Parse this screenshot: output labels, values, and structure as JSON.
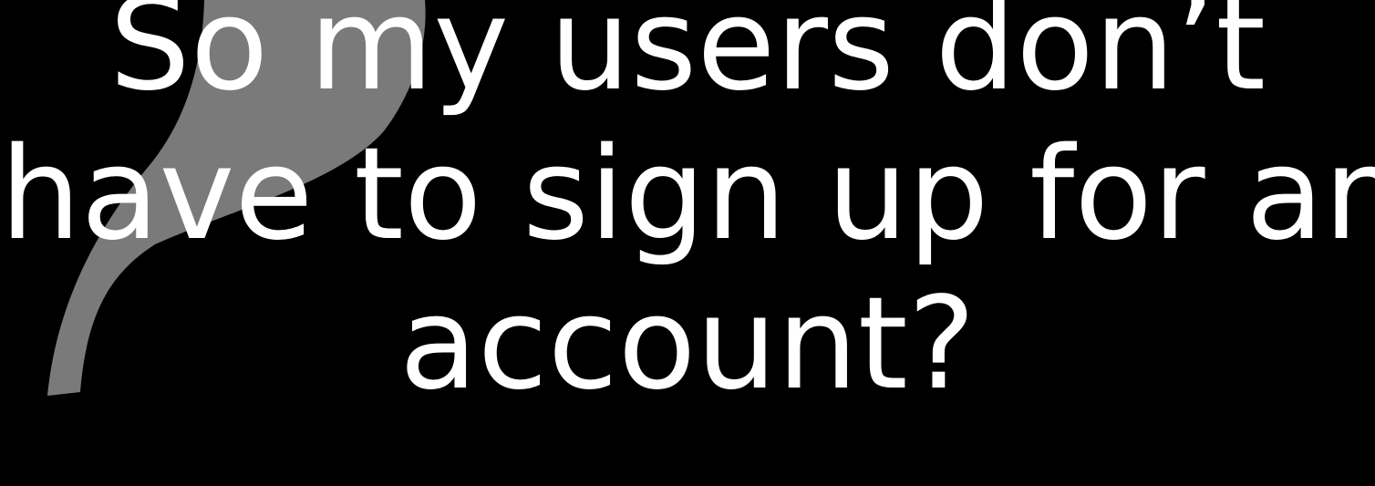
{
  "slide": {
    "lines": [
      "So my users don’t",
      "have to sign up for an",
      "account?"
    ],
    "background_color": "#000000",
    "text_color": "#ffffff",
    "quote_mark_color": "#7a7a7a",
    "decoration_icon": "quote-mark-icon"
  }
}
